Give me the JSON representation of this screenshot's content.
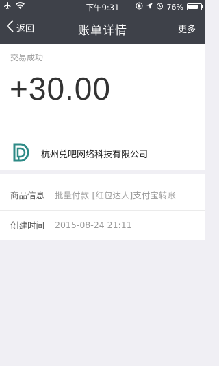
{
  "status_bar": {
    "time": "下午9:31",
    "battery": "76%",
    "battery_level": 0.76
  },
  "nav": {
    "back_label": "返回",
    "title": "账单详情",
    "more_label": "更多"
  },
  "bill": {
    "status": "交易成功",
    "amount": "+30.00",
    "merchant": "杭州兑吧网络科技有限公司"
  },
  "details": [
    {
      "label": "商品信息",
      "value": "批量付款-[红包达人]支付宝转账"
    },
    {
      "label": "创建时间",
      "value": "2015-08-24 21:11"
    }
  ],
  "colors": {
    "topbar": "#3e4149",
    "logo": "#2d8a86"
  }
}
